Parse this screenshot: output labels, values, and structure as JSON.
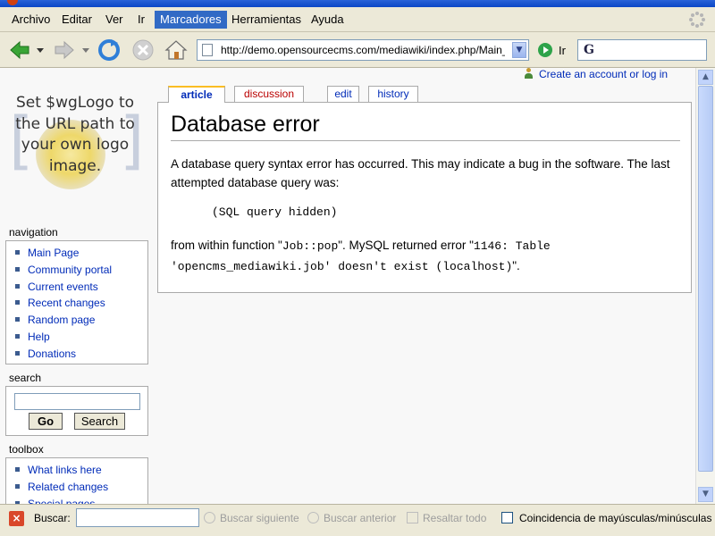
{
  "menubar": {
    "items": [
      "Archivo",
      "Editar",
      "Ver",
      "Ir",
      "Marcadores",
      "Herramientas",
      "Ayuda"
    ]
  },
  "toolbar": {
    "url": "http://demo.opensourcecms.com/mediawiki/index.php/Main_",
    "go_label": "Ir"
  },
  "page": {
    "user_link": "Create an account or log in",
    "logo_text": "Set $wgLogo to the URL path to your own logo image.",
    "tabs": [
      "article",
      "discussion",
      "edit",
      "history"
    ],
    "navigation": {
      "title": "navigation",
      "items": [
        "Main Page",
        "Community portal",
        "Current events",
        "Recent changes",
        "Random page",
        "Help",
        "Donations"
      ]
    },
    "search": {
      "title": "search",
      "value": "",
      "go_label": "Go",
      "search_label": "Search"
    },
    "toolbox": {
      "title": "toolbox",
      "items": [
        "What links here",
        "Related changes",
        "Special pages"
      ]
    },
    "content": {
      "heading": "Database error",
      "para1": "A database query syntax error has occurred. This may indicate a bug in the software. The last attempted database query was:",
      "sql_hidden": "(SQL query hidden)",
      "p2_a": "from within function \"",
      "p2_func": "Job::pop",
      "p2_b": "\". MySQL returned error \"",
      "p2_error": "1146: Table 'opencms_mediawiki.job' doesn't exist (localhost)",
      "p2_c": "\"."
    }
  },
  "findbar": {
    "label": "Buscar:",
    "value": "",
    "next_label": "Buscar siguiente",
    "prev_label": "Buscar anterior",
    "highlight_label": "Resaltar todo",
    "match_case_label": "Coincidencia de mayúsculas/minúsculas"
  }
}
